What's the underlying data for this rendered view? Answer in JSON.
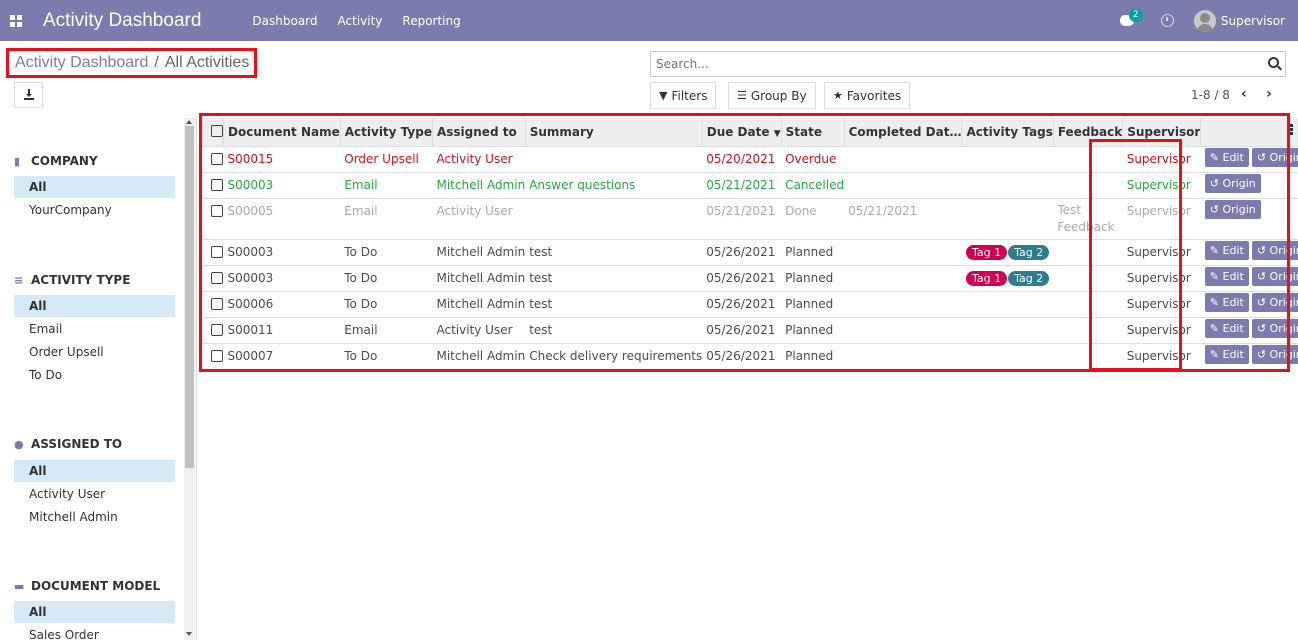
{
  "navbar": {
    "brand": "Activity Dashboard",
    "menu": [
      "Dashboard",
      "Activity",
      "Reporting"
    ],
    "chat_count": "2",
    "user": "Supervisor"
  },
  "breadcrumb": {
    "parent": "Activity Dashboard",
    "separator": "/",
    "current": "All Activities"
  },
  "search": {
    "placeholder": "Search..."
  },
  "search_buttons": {
    "filters": "Filters",
    "group_by": "Group By",
    "favorites": "Favorites"
  },
  "pager": {
    "value": "1-8 / 8"
  },
  "sidebar": {
    "sections": [
      {
        "title": "COMPANY",
        "icon": "building-icon",
        "items": [
          "All",
          "YourCompany"
        ]
      },
      {
        "title": "ACTIVITY TYPE",
        "icon": "list-icon",
        "items": [
          "All",
          "Email",
          "Order Upsell",
          "To Do"
        ]
      },
      {
        "title": "ASSIGNED TO",
        "icon": "users-icon",
        "items": [
          "All",
          "Activity User",
          "Mitchell Admin"
        ]
      },
      {
        "title": "DOCUMENT MODEL",
        "icon": "folder-icon",
        "items": [
          "All",
          "Sales Order"
        ]
      }
    ]
  },
  "table": {
    "columns": [
      "Document Name",
      "Activity Type",
      "Assigned to",
      "Summary",
      "Due Date",
      "State",
      "Completed Dat…",
      "Activity Tags",
      "Feedback",
      "Supervisor"
    ],
    "sort_indicator": "▼",
    "edit_label": "Edit",
    "origin_label": "Origin",
    "rows": [
      {
        "style": "red",
        "doc": "S00015",
        "type": "Order Upsell",
        "assigned": "Activity User",
        "summary": "",
        "due": "05/20/2021",
        "state": "Overdue",
        "completed": "",
        "tags": [],
        "feedback": "",
        "supervisor": "Supervisor",
        "edit": true
      },
      {
        "style": "green",
        "doc": "S00003",
        "type": "Email",
        "assigned": "Mitchell Admin",
        "summary": "Answer questions",
        "due": "05/21/2021",
        "state": "Cancelled",
        "completed": "",
        "tags": [],
        "feedback": "",
        "supervisor": "Supervisor",
        "edit": false
      },
      {
        "style": "gray",
        "doc": "S00005",
        "type": "Email",
        "assigned": "Activity User",
        "summary": "",
        "due": "05/21/2021",
        "state": "Done",
        "completed": "05/21/2021",
        "tags": [],
        "feedback": "Test Feedback",
        "supervisor": "Supervisor",
        "edit": false
      },
      {
        "style": "normal",
        "doc": "S00003",
        "type": "To Do",
        "assigned": "Mitchell Admin",
        "summary": "test",
        "due": "05/26/2021",
        "state": "Planned",
        "completed": "",
        "tags": [
          "Tag 1",
          "Tag 2"
        ],
        "feedback": "",
        "supervisor": "Supervisor",
        "edit": true
      },
      {
        "style": "normal",
        "doc": "S00003",
        "type": "To Do",
        "assigned": "Mitchell Admin",
        "summary": "test",
        "due": "05/26/2021",
        "state": "Planned",
        "completed": "",
        "tags": [
          "Tag 1",
          "Tag 2"
        ],
        "feedback": "",
        "supervisor": "Supervisor",
        "edit": true
      },
      {
        "style": "normal",
        "doc": "S00006",
        "type": "To Do",
        "assigned": "Mitchell Admin",
        "summary": "test",
        "due": "05/26/2021",
        "state": "Planned",
        "completed": "",
        "tags": [],
        "feedback": "",
        "supervisor": "Supervisor",
        "edit": true
      },
      {
        "style": "normal",
        "doc": "S00011",
        "type": "Email",
        "assigned": "Activity User",
        "summary": "test",
        "due": "05/26/2021",
        "state": "Planned",
        "completed": "",
        "tags": [],
        "feedback": "",
        "supervisor": "Supervisor",
        "edit": true
      },
      {
        "style": "normal",
        "doc": "S00007",
        "type": "To Do",
        "assigned": "Mitchell Admin",
        "summary": "Check delivery requirements",
        "due": "05/26/2021",
        "state": "Planned",
        "completed": "",
        "tags": [],
        "feedback": "",
        "supervisor": "Supervisor",
        "edit": true
      }
    ]
  },
  "colors": {
    "brand": "#7c7bad",
    "highlight": "#e5101a",
    "overdue": "#c4161c",
    "cancelled": "#28a745",
    "done": "#aaaaaa",
    "tag1": "#d20051",
    "tag2": "#2b7d8f"
  }
}
